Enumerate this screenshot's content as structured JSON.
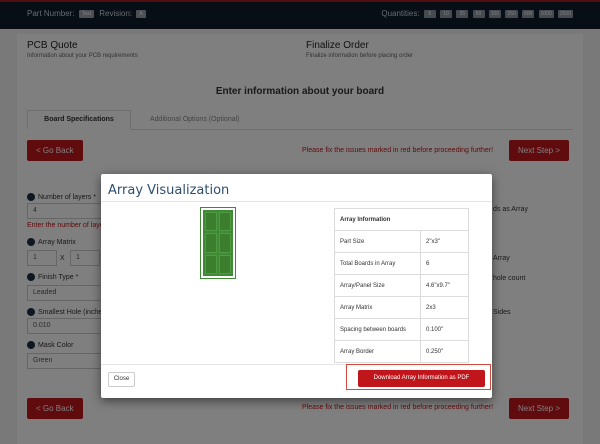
{
  "header": {
    "part_number_label": "Part Number:",
    "part_number_value": "Test",
    "revision_label": "Revision:",
    "revision_value": "A",
    "quantities_label": "Quantities:",
    "quantities": [
      "5",
      "10",
      "25",
      "50",
      "100",
      "250",
      "500",
      "1000",
      "2500"
    ]
  },
  "steps": {
    "quote_title": "PCB Quote",
    "quote_sub": "Information about your PCB requirements",
    "order_title": "Finalize Order",
    "order_sub": "Finalize information before placing order"
  },
  "main": {
    "section_title": "Enter information about your board",
    "tab_active": "Board Specifications",
    "tab_other": "Additional Options (Optional)",
    "go_back": "< Go Back",
    "next_step": "Next Step >",
    "fix_issues": "Please fix the issues marked in red before proceeding further!",
    "layers_label": "Number of layers *",
    "layers_value": "4",
    "layers_error": "Enter the number of layers",
    "array_label": "Array Matrix",
    "array_a": "1",
    "array_x": "X",
    "array_b": "1",
    "finish_label": "Finish Type *",
    "finish_value": "Leaded",
    "hole_label": "Smallest Hole (inches)",
    "hole_value": "0.010",
    "mask_label": "Mask Color",
    "mask_value": "Green",
    "right_text_1": "ds as Array",
    "right_text_2": "Array",
    "right_text_3": "hole count",
    "right_text_4": "Sides"
  },
  "modal": {
    "title": "Array Visualization",
    "table_header": "Array Information",
    "rows": [
      {
        "label": "Part Size",
        "value": "2\"x3\""
      },
      {
        "label": "Total Boards in Array",
        "value": "6"
      },
      {
        "label": "Array/Panel Size",
        "value": "4.6\"x9.7\""
      },
      {
        "label": "Array Matrix",
        "value": "2x3"
      },
      {
        "label": "Spacing between boards",
        "value": "0.100\""
      },
      {
        "label": "Array Border",
        "value": "0.250\""
      }
    ],
    "close_label": "Close",
    "download_label": "Download Array Information as PDF",
    "board_color": "#3f8a34"
  }
}
